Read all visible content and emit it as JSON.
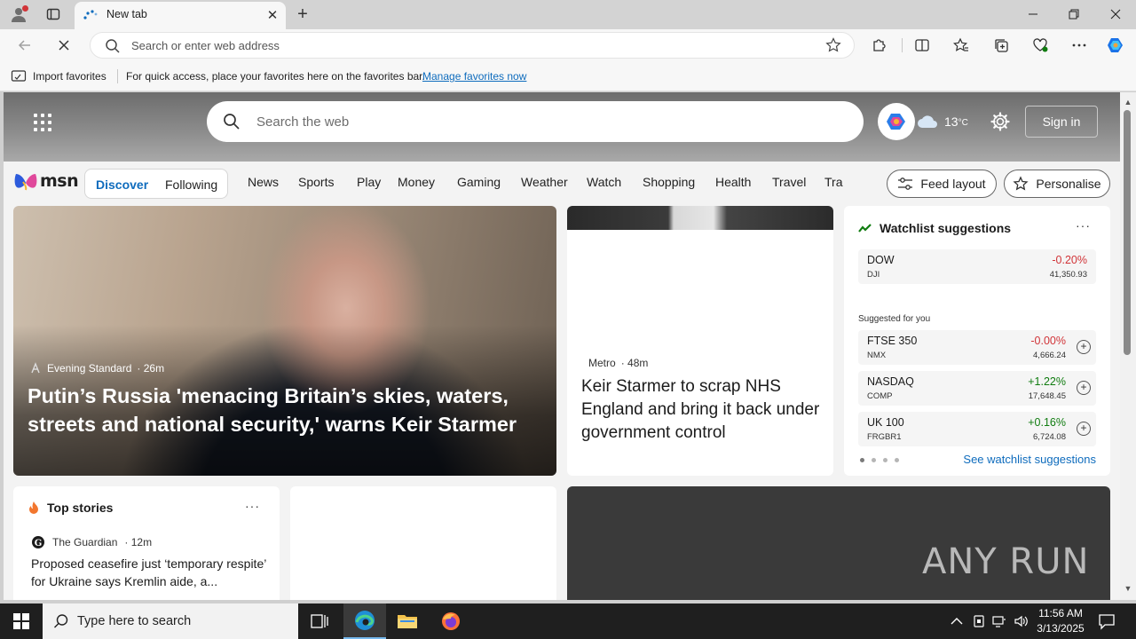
{
  "browser": {
    "tab_title": "New tab",
    "address_placeholder": "Search or enter web address",
    "favorites_bar": {
      "import_label": "Import favorites",
      "hint": "For quick access, place your favorites here on the favorites bar.",
      "manage_link": "Manage favorites now"
    }
  },
  "msn": {
    "search_placeholder": "Search the web",
    "weather_temp": "13",
    "weather_unit": "°C",
    "signin_label": "Sign in",
    "logo_text": "msn",
    "feed_tabs": {
      "discover": "Discover",
      "following": "Following"
    },
    "categories": [
      "News",
      "Sports",
      "Play",
      "Money",
      "Gaming",
      "Weather",
      "Watch",
      "Shopping",
      "Health",
      "Travel",
      "Tra"
    ],
    "feed_layout_label": "Feed layout",
    "personalise_label": "Personalise",
    "main_story": {
      "source": "Evening Standard",
      "age": "· 26m",
      "headline": "Putin’s Russia 'menacing Britain’s skies, waters, streets and national security,' warns Keir Starmer"
    },
    "story2": {
      "source": "Metro",
      "age": "· 48m",
      "headline": "Keir Starmer to scrap NHS England and bring it back under government control"
    },
    "watchlist": {
      "title": "Watchlist suggestions",
      "more": "···",
      "primary": {
        "symbol": "DOW",
        "exchange": "DJI",
        "change": "-0.20%",
        "price": "41,350.93",
        "direction": "down"
      },
      "suggested_label": "Suggested for you",
      "suggested": [
        {
          "symbol": "FTSE 350",
          "exchange": "NMX",
          "change": "-0.00%",
          "price": "4,666.24",
          "direction": "down"
        },
        {
          "symbol": "NASDAQ",
          "exchange": "COMP",
          "change": "+1.22%",
          "price": "17,648.45",
          "direction": "up"
        },
        {
          "symbol": "UK 100",
          "exchange": "FRGBR1",
          "change": "+0.16%",
          "price": "6,724.08",
          "direction": "up"
        }
      ],
      "see_all": "See watchlist suggestions"
    },
    "top_stories": {
      "title": "Top stories",
      "more": "···",
      "source": "The Guardian",
      "age": "· 12m",
      "headline": "Proposed ceasefire just ‘temporary respite’ for Ukraine says Kremlin aide, a..."
    },
    "watermark": "ANY RUN"
  },
  "taskbar": {
    "search_placeholder": "Type here to search",
    "time": "11:56 AM",
    "date": "3/13/2025"
  },
  "colors": {
    "accent": "#0f6cbd",
    "negative": "#d13438",
    "positive": "#107c10",
    "taskbar": "#1f1f1f"
  }
}
